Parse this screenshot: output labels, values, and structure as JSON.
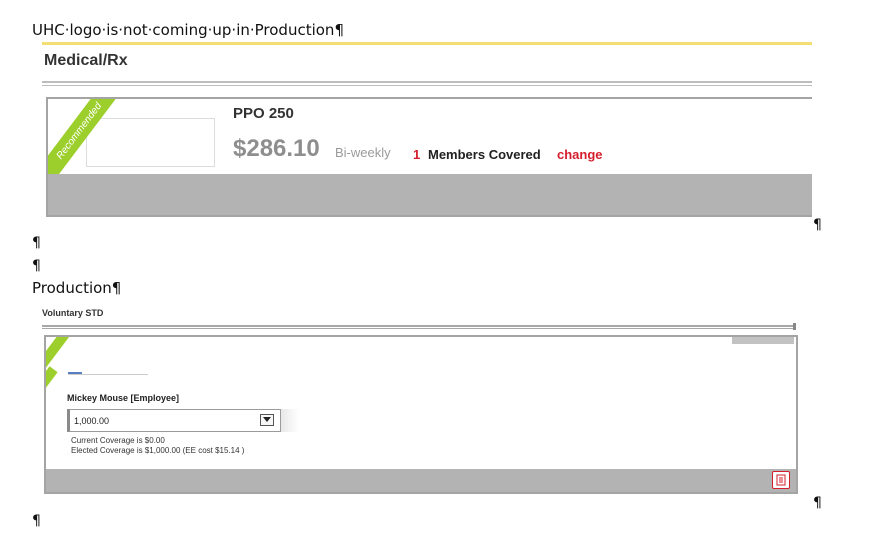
{
  "doc": {
    "heading": "UHC·logo·is·not·coming·up·in·Production¶",
    "pilcrow": "¶",
    "production_label": "Production¶"
  },
  "shot1": {
    "section_title": "Medical/Rx",
    "ribbon": "Recommended",
    "plan_name": "PPO 250",
    "price": "$286.10",
    "frequency": "Bi-weekly",
    "members_count": "1",
    "members_label": "Members Covered",
    "change_link": "change",
    "accent_color": "#d4202e",
    "ribbon_color": "#9ccf2c"
  },
  "shot2": {
    "section_title": "Voluntary STD",
    "member_name": "Mickey Mouse [Employee]",
    "coverage_select": "1,000.00",
    "current_coverage": "Current Coverage is $0.00",
    "elected_coverage": "Elected Coverage is $1,000.00 (EE cost $15.14 )",
    "doc_icon": "document-icon"
  }
}
